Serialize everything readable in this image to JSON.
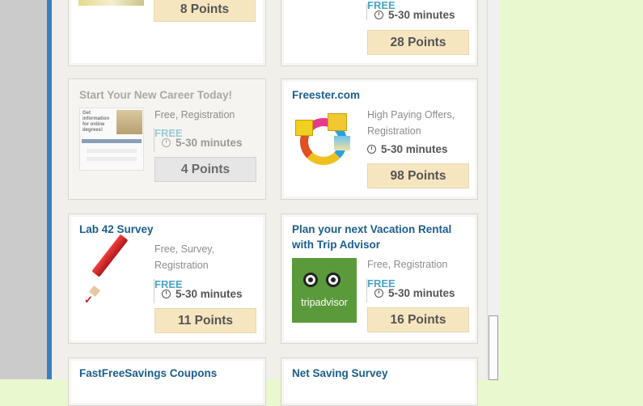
{
  "offers": [
    {
      "id": "top-left",
      "points": "8 Points"
    },
    {
      "id": "top-right",
      "free": "FREE",
      "time": "5-30 minutes",
      "points": "28 Points"
    },
    {
      "id": "career",
      "title": "Start Your New Career Today!",
      "categories": "Free, Registration",
      "free": "FREE",
      "time": "5-30 minutes",
      "points": "4 Points",
      "thumb_text": "Get information for online degrees!"
    },
    {
      "id": "freester",
      "title": "Freester.com",
      "categories_line1": "High Paying Offers,",
      "categories_line2": "Registration",
      "time": "5-30 minutes",
      "points": "98 Points"
    },
    {
      "id": "lab42",
      "title": "Lab 42 Survey",
      "categories_line1": "Free, Survey,",
      "categories_line2": "Registration",
      "free": "FREE",
      "time": "5-30 minutes",
      "points": "11 Points"
    },
    {
      "id": "tripadvisor",
      "title_line1": "Plan your next Vacation Rental",
      "title_line2": "with Trip Advisor",
      "categories": "Free, Registration",
      "free": "FREE",
      "time": "5-30 minutes",
      "points": "16 Points",
      "logo_text": "tripadvisor"
    },
    {
      "id": "fastfree",
      "title": "FastFreeSavings Coupons"
    },
    {
      "id": "netsaving",
      "title": "Net Saving Survey"
    }
  ],
  "colors": {
    "accent_blue": "#1a5d8e",
    "free_blue": "#4aa3c6",
    "points_bg": "#f6e6c0",
    "page_bg": "#e9f8cf"
  }
}
